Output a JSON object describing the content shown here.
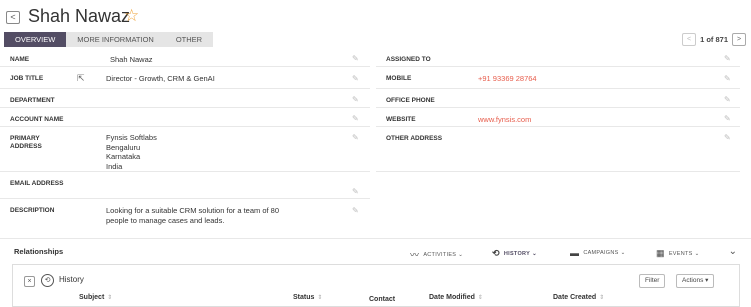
{
  "header": {
    "back_icon": "<",
    "title": "Shah Nawaz",
    "star_icon": "☆"
  },
  "tabs": [
    {
      "label": "OVERVIEW",
      "active": true
    },
    {
      "label": "MORE INFORMATION",
      "active": false
    },
    {
      "label": "OTHER",
      "active": false
    }
  ],
  "pager": {
    "prev": "<",
    "text": "1 of 871",
    "next": ">"
  },
  "fields_left": [
    {
      "label": "NAME",
      "value": "Shah Nawaz"
    },
    {
      "label": "JOB TITLE",
      "value": "Director - Growth, CRM & GenAI"
    },
    {
      "label": "DEPARTMENT",
      "value": ""
    },
    {
      "label": "ACCOUNT NAME",
      "value": ""
    },
    {
      "label": "PRIMARY ADDRESS",
      "value_lines": [
        "Fynsis Softlabs",
        "Bengaluru",
        "Karnataka",
        "India"
      ]
    },
    {
      "label": "EMAIL ADDRESS",
      "value": ""
    },
    {
      "label": "DESCRIPTION",
      "value_lines": [
        "Looking for a suitable CRM solution for a team of 80",
        "people to manage cases and leads."
      ]
    }
  ],
  "fields_right": [
    {
      "label": "ASSIGNED TO",
      "value": ""
    },
    {
      "label": "MOBILE",
      "value": "+91 93369 28764"
    },
    {
      "label": "OFFICE PHONE",
      "value": ""
    },
    {
      "label": "WEBSITE",
      "value": "www.fynsis.com"
    },
    {
      "label": "OTHER ADDRESS",
      "value": ""
    }
  ],
  "relationships": {
    "title": "Relationships",
    "tabs": [
      {
        "label": "ACTIVITIES",
        "icon": "activity-icon",
        "active": false
      },
      {
        "label": "HISTORY",
        "icon": "history-icon",
        "active": true
      },
      {
        "label": "CAMPAIGNS",
        "icon": "campaign-icon",
        "active": false
      },
      {
        "label": "EVENTS",
        "icon": "events-icon",
        "active": false
      }
    ]
  },
  "history_panel": {
    "title": "History",
    "filter_label": "Filter",
    "actions_label": "Actions",
    "columns": [
      "Subject",
      "Status",
      "Contact",
      "Date Modified",
      "Date Created"
    ]
  },
  "colors": {
    "accent": "#534d64",
    "link": "#e75d4c",
    "star": "#f0a742"
  }
}
